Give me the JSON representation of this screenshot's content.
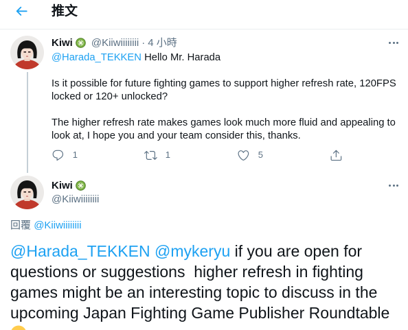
{
  "header": {
    "title": "推文",
    "back_icon": "arrow-left-icon"
  },
  "colors": {
    "accent": "#1da1f2",
    "text": "#0f1419",
    "secondary": "#5b7083",
    "divider": "#ebeef0",
    "thread_line": "#c4cfd6"
  },
  "parent_tweet": {
    "author": {
      "name": "Kiwi",
      "badge_icon": "kiwi-fruit-icon",
      "handle": "@Kiiwiiiiiiii"
    },
    "time_separator": "·",
    "time": "4 小時",
    "more_icon": "more-icon",
    "mention": "@Harada_TEKKEN",
    "greeting": "Hello Mr. Harada",
    "paragraphs": [
      "Is it possible for future fighting games to support higher refresh rate, 120FPS locked or 120+ unlocked?",
      "The higher refresh rate makes games look much more fluid and appealing to look at, I hope you and your team consider this, thanks."
    ],
    "actions": {
      "reply_icon": "reply-icon",
      "reply_count": "1",
      "retweet_icon": "retweet-icon",
      "retweet_count": "1",
      "like_icon": "heart-icon",
      "like_count": "5",
      "share_icon": "share-icon"
    }
  },
  "focused_tweet": {
    "author": {
      "name": "Kiwi",
      "badge_icon": "kiwi-fruit-icon",
      "handle": "@Kiiwiiiiiiii"
    },
    "more_icon": "more-icon",
    "reply_label": "回覆",
    "reply_to": "@Kiiwiiiiiiii",
    "mentions": [
      "@Harada_TEKKEN",
      "@mykeryu"
    ],
    "text": "if you are open for questions or suggestions  higher refresh in fighting games might be an interesting topic to discuss in the upcoming Japan Fighting Game Publisher Roundtable",
    "emoji_icon": "smiling-face-emoji-icon"
  }
}
